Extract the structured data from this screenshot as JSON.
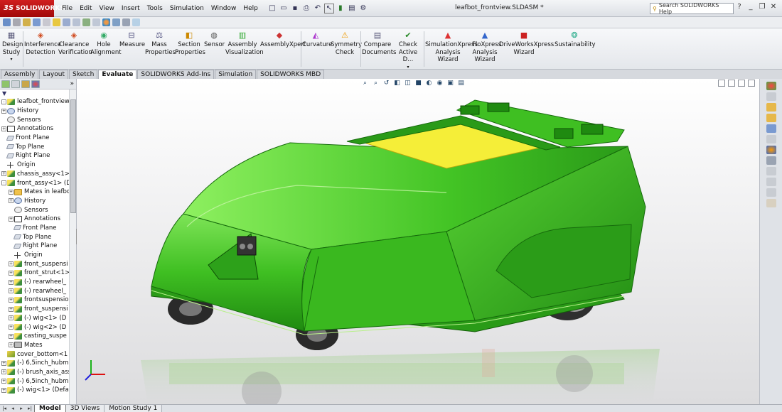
{
  "app": {
    "logo_text": "SOLIDWORKS",
    "window_title": "leafbot_frontview.SLDASM *",
    "search_placeholder": "Search SOLIDWORKS Help"
  },
  "menu": [
    "File",
    "Edit",
    "View",
    "Insert",
    "Tools",
    "Simulation",
    "Window",
    "Help"
  ],
  "ribbon": {
    "design_study": "Design Study",
    "interference_detection": "Interference Detection",
    "clearance_verification": "Clearance Verification",
    "hole_alignment": "Hole Alignment",
    "measure": "Measure",
    "mass_properties": "Mass Properties",
    "section_properties": "Section Properties",
    "sensor": "Sensor",
    "assembly_visualization": "Assembly Visualization",
    "assemblyxpert": "AssemblyXpert",
    "curvature": "Curvature",
    "symmetry_check": "Symmetry Check",
    "compare_documents": "Compare Documents",
    "check_active": "Check Active D...",
    "simulationxpress": "SimulationXpress Analysis Wizard",
    "floxpress": "FloXpress Analysis Wizard",
    "driveworksxpress": "DriveWorksXpress Wizard",
    "sustainability": "Sustainability"
  },
  "tabs": [
    "Assembly",
    "Layout",
    "Sketch",
    "Evaluate",
    "SOLIDWORKS Add-Ins",
    "Simulation",
    "SOLIDWORKS MBD"
  ],
  "active_tab": "Evaluate",
  "tree": [
    {
      "label": "leafbot_frontview  (",
      "icon": "asm",
      "depth": 0,
      "exp": "-"
    },
    {
      "label": "History",
      "icon": "hist",
      "depth": 0,
      "exp": "+"
    },
    {
      "label": "Sensors",
      "icon": "sensor",
      "depth": 0,
      "exp": ""
    },
    {
      "label": "Annotations",
      "icon": "ann",
      "depth": 0,
      "exp": "+"
    },
    {
      "label": "Front Plane",
      "icon": "plane",
      "depth": 0,
      "exp": ""
    },
    {
      "label": "Top Plane",
      "icon": "plane",
      "depth": 0,
      "exp": ""
    },
    {
      "label": "Right Plane",
      "icon": "plane",
      "depth": 0,
      "exp": ""
    },
    {
      "label": "Origin",
      "icon": "origin",
      "depth": 0,
      "exp": ""
    },
    {
      "label": "chassis_assy<1>",
      "icon": "asm",
      "depth": 0,
      "exp": "+"
    },
    {
      "label": "front_assy<1> (D",
      "icon": "asm",
      "depth": 0,
      "exp": "-"
    },
    {
      "label": "Mates in leafbot",
      "icon": "folder",
      "depth": 1,
      "exp": "+"
    },
    {
      "label": "History",
      "icon": "hist",
      "depth": 1,
      "exp": "+"
    },
    {
      "label": "Sensors",
      "icon": "sensor",
      "depth": 1,
      "exp": ""
    },
    {
      "label": "Annotations",
      "icon": "ann",
      "depth": 1,
      "exp": "+"
    },
    {
      "label": "Front Plane",
      "icon": "plane",
      "depth": 1,
      "exp": ""
    },
    {
      "label": "Top Plane",
      "icon": "plane",
      "depth": 1,
      "exp": ""
    },
    {
      "label": "Right Plane",
      "icon": "plane",
      "depth": 1,
      "exp": ""
    },
    {
      "label": "Origin",
      "icon": "origin",
      "depth": 1,
      "exp": ""
    },
    {
      "label": "front_suspensi",
      "icon": "asm",
      "depth": 1,
      "exp": "+"
    },
    {
      "label": "front_strut<1>",
      "icon": "asm",
      "depth": 1,
      "exp": "+"
    },
    {
      "label": "(-) rearwheel_",
      "icon": "asm",
      "depth": 1,
      "exp": "+"
    },
    {
      "label": "(-) rearwheel_",
      "icon": "asm",
      "depth": 1,
      "exp": "+"
    },
    {
      "label": "frontsuspensio",
      "icon": "asm",
      "depth": 1,
      "exp": "+"
    },
    {
      "label": "front_suspensi",
      "icon": "asm",
      "depth": 1,
      "exp": "+"
    },
    {
      "label": "(-) wig<1> (D",
      "icon": "asm",
      "depth": 1,
      "exp": "+"
    },
    {
      "label": "(-) wig<2> (D",
      "icon": "asm",
      "depth": 1,
      "exp": "+"
    },
    {
      "label": "casting_suspe",
      "icon": "asm",
      "depth": 1,
      "exp": "+"
    },
    {
      "label": "Mates",
      "icon": "mates",
      "depth": 1,
      "exp": "+"
    },
    {
      "label": "cover_bottom<1",
      "icon": "part",
      "depth": 0,
      "exp": ""
    },
    {
      "label": "(-) 6,5inch_hubm",
      "icon": "asm",
      "depth": 0,
      "exp": "+"
    },
    {
      "label": "(-) brush_axis_ass",
      "icon": "asm",
      "depth": 0,
      "exp": "+"
    },
    {
      "label": "(-) 6,5inch_hubm",
      "icon": "asm",
      "depth": 0,
      "exp": "+"
    },
    {
      "label": "(-) wig<1> (Defa",
      "icon": "asm",
      "depth": 0,
      "exp": "+"
    }
  ],
  "bottom_tabs": [
    "Model",
    "3D Views",
    "Motion Study 1"
  ],
  "active_bottom_tab": "Model",
  "colors": {
    "body_green": "#3fbf22",
    "body_green_dark": "#1f8a10",
    "top_yellow": "#f5ee38",
    "logo_red": "#c01010"
  }
}
